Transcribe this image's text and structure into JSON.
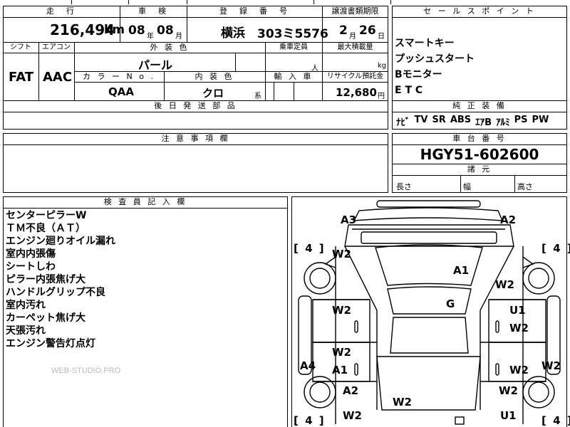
{
  "top_headers": {
    "mileage": "走　行",
    "inspection": "車　検",
    "registration": "登　録　番　号",
    "transfer_deadline": "譲渡書類期限",
    "sales_points": "セ ー ル ス ポ イ ン ト"
  },
  "mileage": {
    "value": "216,494",
    "unit": "km"
  },
  "inspection": {
    "year": "08",
    "year_unit": "年",
    "month": "08",
    "month_unit": "月"
  },
  "registration": {
    "place": "横浜",
    "number": "303ミ5576"
  },
  "transfer_deadline": {
    "month": "2",
    "month_unit": "月",
    "day": "26",
    "day_unit": "日"
  },
  "second_headers": {
    "shift": "シフト",
    "aircon": "エアコン",
    "exterior_color": "外 装 色",
    "capacity": "乗車定員",
    "max_load": "最大積載量",
    "color_no": "カ ラ ー N o .",
    "interior_color": "内 装 色",
    "import": "輸 入 車",
    "recycle": "リサイクル預託金",
    "after_parts": "後 日 発 送 部 品"
  },
  "shift": "FAT",
  "aircon": "AAC",
  "exterior_color": "パール",
  "capacity_unit": "人",
  "max_load_unit": "kg",
  "color_no": "QAA",
  "interior_color": {
    "value": "クロ",
    "suffix": "系"
  },
  "recycle": {
    "value": "12,680",
    "unit": "円"
  },
  "sales_points": [
    "スマートキー",
    "プッシュスタート",
    "Bモニター",
    "E T C"
  ],
  "equipment": {
    "header": "純 正 装 備",
    "items": [
      "ﾅﾋﾞ",
      "TV",
      "SR",
      "ABS",
      "ｴｱB",
      "ｱﾙﾐ",
      "PS",
      "PW"
    ]
  },
  "caution": {
    "header": "注 意 事 項 欄"
  },
  "chassis": {
    "header": "車 台 番 号",
    "value": "HGY51-602600"
  },
  "dimensions": {
    "header": "諸 元",
    "length": "長さ",
    "width": "幅",
    "height": "高さ"
  },
  "inspector": {
    "header": "検 査 員 記 入 欄",
    "notes": [
      "センターピラーW",
      "ＴＭ不良（ＡＴ）",
      "エンジン廻りオイル漏れ",
      "室内内張傷",
      "シートしわ",
      "ピラー内張焦げ大",
      "ハンドルグリップ不良",
      "室内汚れ",
      "カーペット焦げ大",
      "天張汚れ",
      "エンジン警告灯点灯"
    ]
  },
  "watermark": "WEB-STUDIO.PRO",
  "diagram": {
    "tyre_front_left": "[ 4 ]",
    "tyre_front_right": "[ 4 ]",
    "tyre_rear_left": "[ 4 ]",
    "tyre_rear_right": "[ 4 ]",
    "marks": {
      "front_left_corner": "A3",
      "front_right_corner": "A2",
      "front_left_fender": "W2",
      "roof": "A1",
      "front_right_fender": "W2",
      "cabin": "G",
      "left_front_door": "W2",
      "right_front_door_a": "U1",
      "right_front_door_b": "W2",
      "left_rear_door_a": "W2",
      "left_rear_door_b": "A1",
      "right_rear_door": "W2",
      "left_rocker": "A4",
      "right_rocker": "W2",
      "left_rear_fender_a": "A2",
      "left_rear_fender_b": "W2",
      "tailgate": "W2",
      "right_rear_fender_a": "W2",
      "right_rear_fender_b": "U1"
    }
  }
}
